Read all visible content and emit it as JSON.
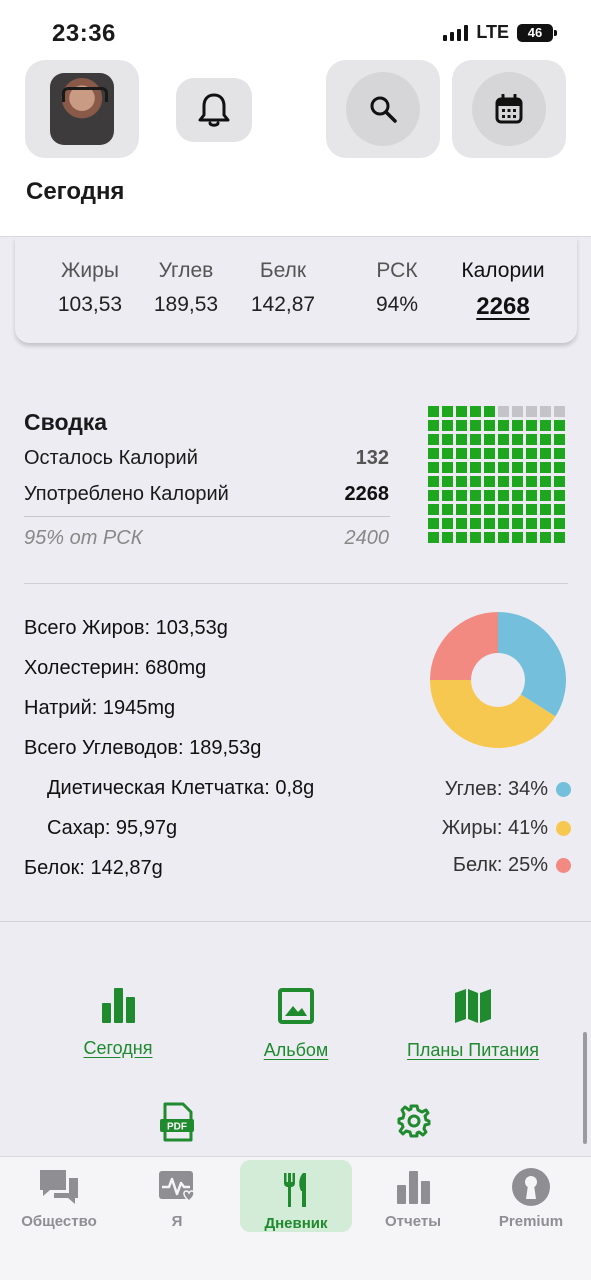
{
  "status_bar": {
    "time": "23:36",
    "network": "LTE",
    "battery": "46"
  },
  "header": {
    "title": "Сегодня"
  },
  "macros": {
    "fat": {
      "label": "Жиры",
      "value": "103,53"
    },
    "carbs": {
      "label": "Углев",
      "value": "189,53"
    },
    "protein": {
      "label": "Белк",
      "value": "142,87"
    },
    "rsk": {
      "label": "РСК",
      "value": "94%"
    },
    "calories": {
      "label": "Калории",
      "value": "2268"
    }
  },
  "summary": {
    "title": "Сводка",
    "remaining_label": "Осталось Калорий",
    "remaining_value": "132",
    "consumed_label": "Употреблено Калорий",
    "consumed_value": "2268",
    "rsk_label": "95% от РСК",
    "rsk_value": "2400",
    "waffle_filled_fraction": 0.95
  },
  "nutrition": {
    "total_fat": "Всего Жиров: 103,53g",
    "cholesterol": "Холестерин: 680mg",
    "sodium": "Натрий: 1945mg",
    "total_carbs": "Всего Углеводов: 189,53g",
    "fiber": "Диетическая Клетчатка: 0,8g",
    "sugar": "Сахар: 95,97g",
    "protein": "Белок: 142,87g"
  },
  "chart_data": {
    "type": "pie",
    "categories": [
      "Углев",
      "Жиры",
      "Белк"
    ],
    "values": [
      34,
      41,
      25
    ],
    "colors": [
      "#74c0dc",
      "#f7c84f",
      "#f28a82"
    ],
    "legend": [
      "Углев: 34%",
      "Жиры: 41%",
      "Белк: 25%"
    ]
  },
  "actions": {
    "today": "Сегодня",
    "album": "Альбом",
    "meal_plans": "Планы Питания"
  },
  "tabs": {
    "community": "Общество",
    "me": "Я",
    "diary": "Дневник",
    "reports": "Отчеты",
    "premium": "Premium"
  },
  "colors": {
    "accent": "#1f8a2e",
    "waffle_green": "#1fa61f",
    "background": "#ececf2"
  },
  "icons": [
    "bell-icon",
    "search-icon",
    "calendar-icon",
    "bar-chart-icon",
    "image-icon",
    "map-icon",
    "pdf-icon",
    "gear-icon",
    "chat-icon",
    "pulse-heart-icon",
    "fork-knife-icon",
    "reports-icon",
    "keyhole-icon"
  ]
}
